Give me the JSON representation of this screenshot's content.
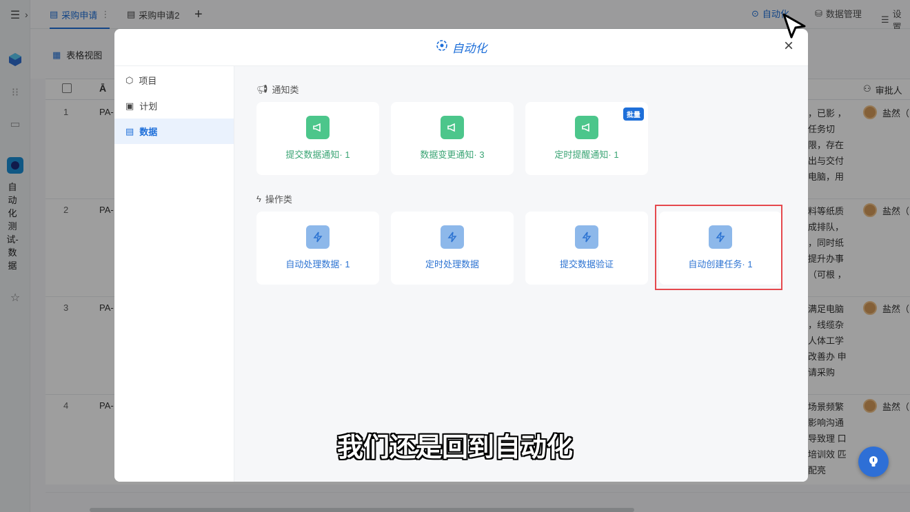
{
  "tabs": [
    {
      "label": "采购申请",
      "active": true
    },
    {
      "label": "采购申请2",
      "active": false
    }
  ],
  "topbar": {
    "automation_label": "自动化",
    "data_manage_label": "数据管理",
    "settings_label": "设置"
  },
  "view": {
    "label": "表格视图"
  },
  "sidebar": {
    "vertical_name": "自动化测试-数据"
  },
  "table": {
    "approver_header": "审批人",
    "rows": [
      {
        "num": "1",
        "id": "PA-",
        "text": "，已影 ，任务切 限，存在 出与交付 电脑，用",
        "approver": "盐然（"
      },
      {
        "num": "2",
        "id": "PA-",
        "text": "料等纸质 成排队， ，同时纸 提升办事 （可根 ，",
        "approver": "盐然（"
      },
      {
        "num": "3",
        "id": "PA-",
        "text": "满足电脑 ，线缆杂 人体工学 改善办 申请采购",
        "approver": "盐然（"
      },
      {
        "num": "4",
        "id": "PA-",
        "text": "场景频繁 影响沟通 导致理 口培训效 匹配亮",
        "approver": "盐然（"
      }
    ]
  },
  "modal": {
    "title": "自动化",
    "nav": [
      {
        "label": "项目",
        "icon": "cube-icon",
        "active": false
      },
      {
        "label": "计划",
        "icon": "plan-icon",
        "active": false
      },
      {
        "label": "数据",
        "icon": "document-icon",
        "active": true
      }
    ],
    "notify_section": "通知类",
    "action_section": "操作类",
    "notify_cards": [
      {
        "label": "提交数据通知· 1",
        "badge": ""
      },
      {
        "label": "数据变更通知· 3",
        "badge": ""
      },
      {
        "label": "定时提醒通知· 1",
        "badge": "批量"
      }
    ],
    "action_cards": [
      {
        "label": "自动处理数据· 1"
      },
      {
        "label": "定时处理数据"
      },
      {
        "label": "提交数据验证"
      },
      {
        "label": "自动创建任务· 1"
      }
    ]
  },
  "subtitle": "我们还是回到自动化",
  "colors": {
    "accent": "#1e6fd9",
    "notify_green": "#4cc68b",
    "action_blue": "#8db8ea",
    "highlight_red": "#e5484d"
  }
}
